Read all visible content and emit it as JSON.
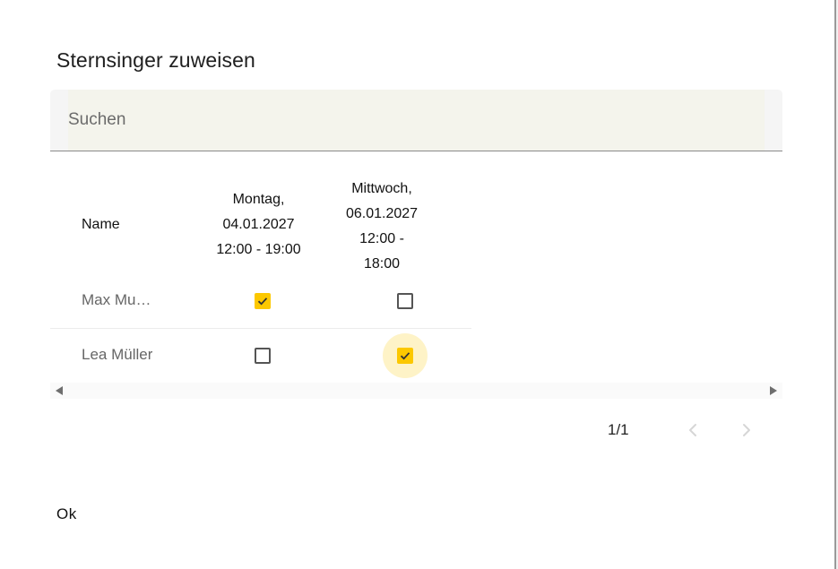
{
  "dialog": {
    "title": "Sternsinger zuweisen"
  },
  "search": {
    "placeholder": "Suchen",
    "value": ""
  },
  "table": {
    "headers": {
      "name": "Name",
      "col1_line1": "Montag,",
      "col1_line2": "04.01.2027",
      "col1_line3": "12:00 - 19:00",
      "col2_line1": "Mittwoch,",
      "col2_line2": "06.01.2027",
      "col2_line3": "12:00 -",
      "col2_line4": "18:00"
    },
    "rows": [
      {
        "name": "Max Mu…",
        "col1_checked": true,
        "col2_checked": false
      },
      {
        "name": "Lea Müller",
        "col1_checked": false,
        "col2_checked": true
      }
    ]
  },
  "pagination": {
    "label": "1/1",
    "prev_enabled": false,
    "next_enabled": false
  },
  "actions": {
    "ok_label": "Ok"
  },
  "colors": {
    "accent": "#fcc800",
    "search_bg": "#f4f4ec"
  }
}
